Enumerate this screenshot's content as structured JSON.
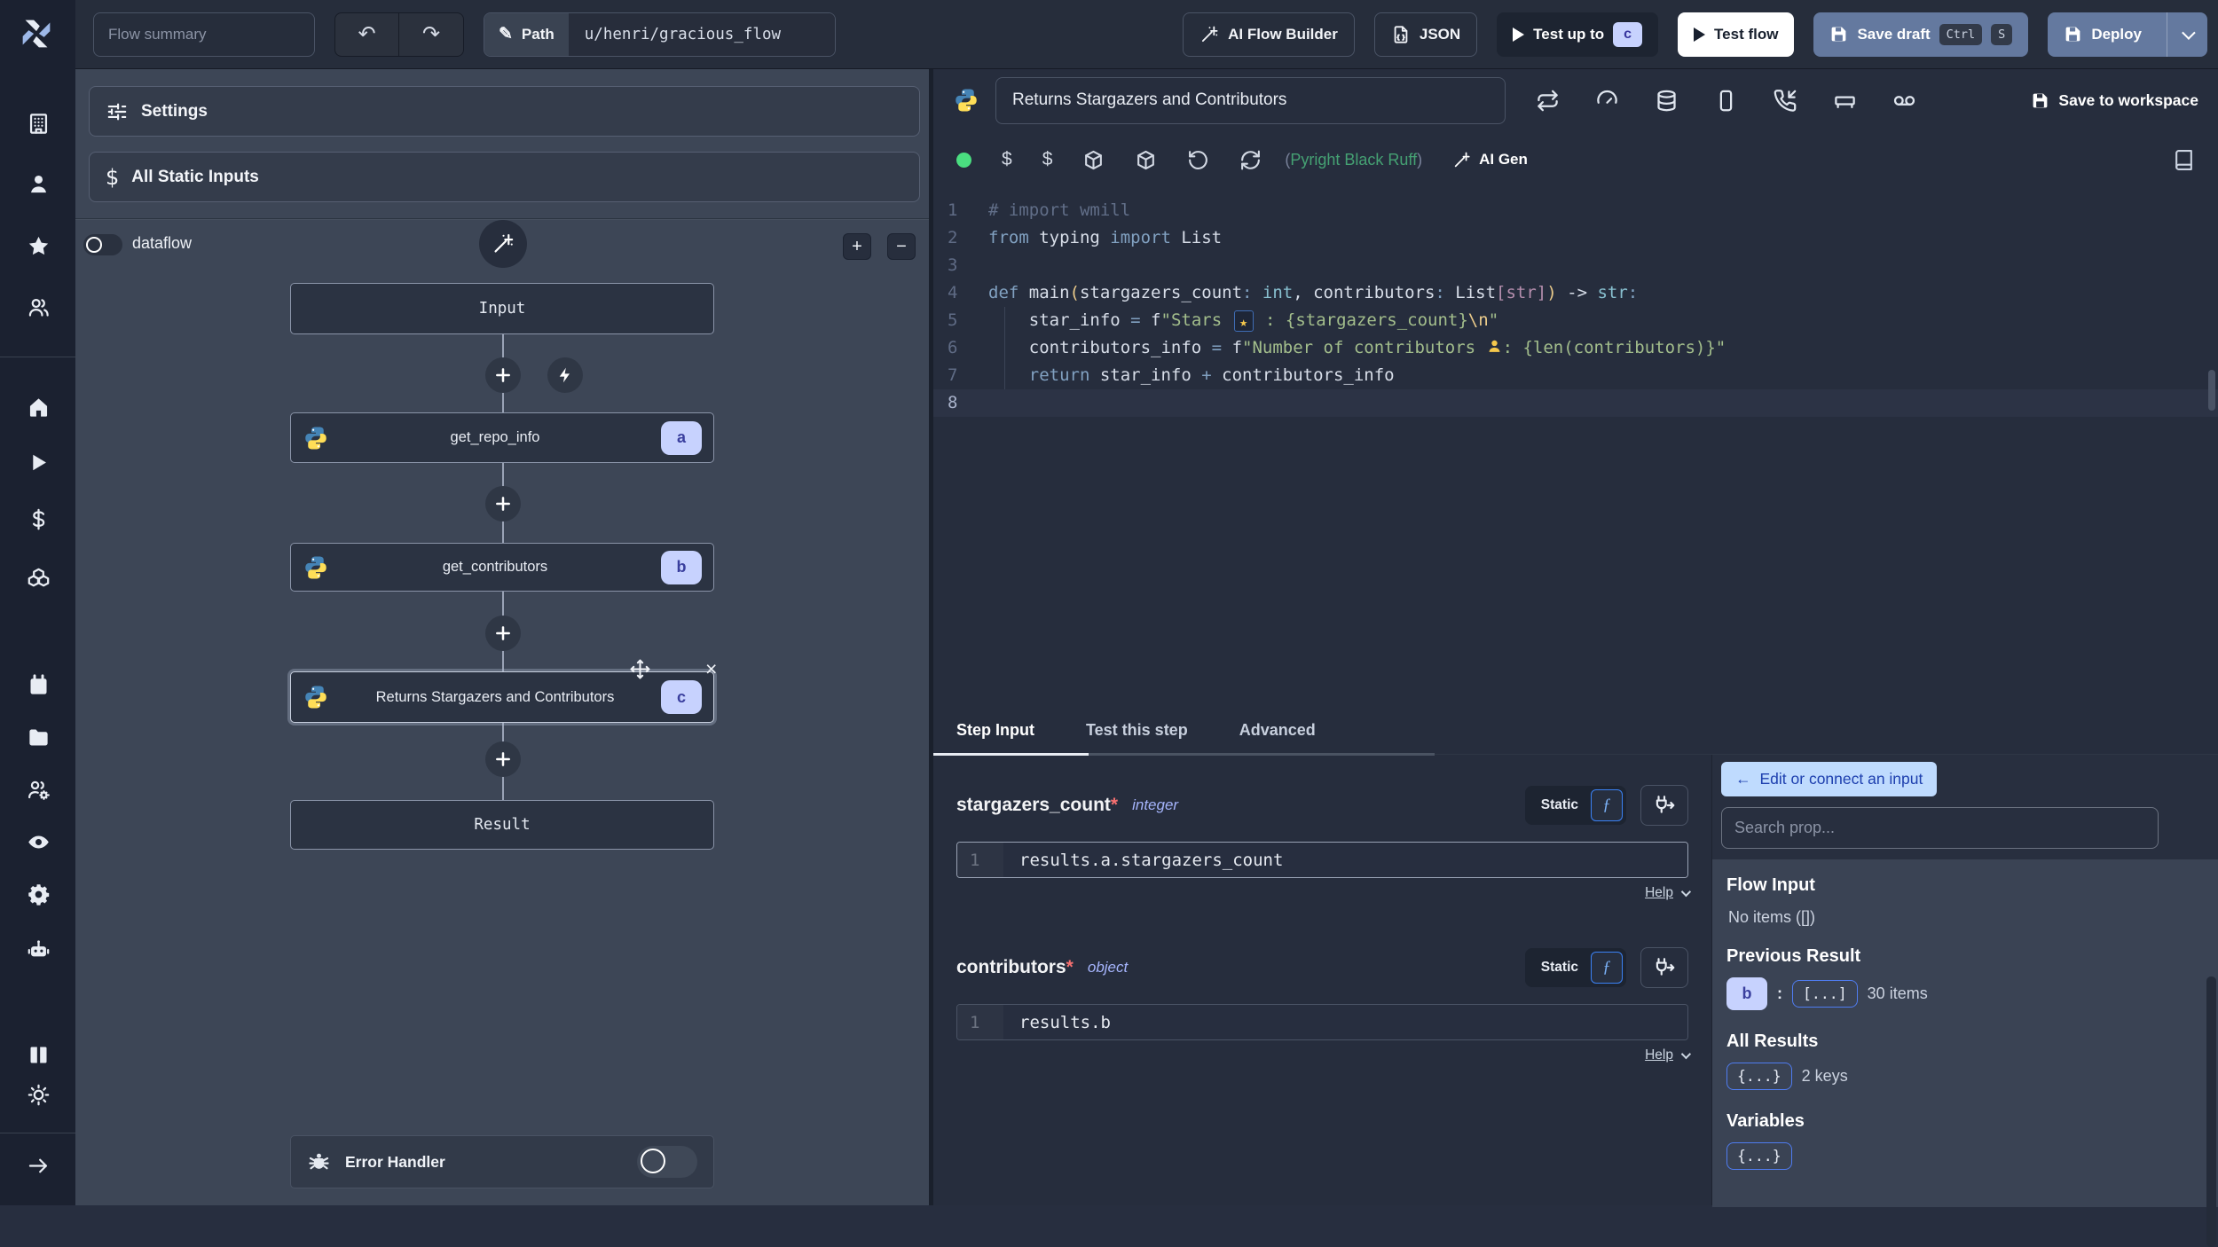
{
  "topbar": {
    "flow_summary_placeholder": "Flow summary",
    "path_label": "Path",
    "path_value": "u/henri/gracious_flow",
    "ai_flow_builder_label": "AI Flow Builder",
    "json_label": "JSON",
    "test_up_to_label": "Test up to",
    "test_up_to_badge": "c",
    "test_flow_label": "Test flow",
    "save_draft_label": "Save draft",
    "kbd_ctrl": "Ctrl",
    "kbd_s": "S",
    "deploy_label": "Deploy"
  },
  "sidebar": {
    "groups": [
      [
        "building",
        "user",
        "star",
        "users"
      ],
      [
        "home",
        "play",
        "dollar",
        "boxes"
      ],
      [
        "calendar",
        "folder",
        "users-cog",
        "eye",
        "gear",
        "robot"
      ],
      [
        "books",
        "sun"
      ],
      [
        "arrow-right"
      ]
    ]
  },
  "flow": {
    "settings_label": "Settings",
    "static_inputs_label": "All Static Inputs",
    "dataflow_label": "dataflow",
    "zoom_in": "+",
    "zoom_out": "−",
    "nodes": {
      "input": "Input",
      "a": {
        "label": "get_repo_info",
        "badge": "a"
      },
      "b": {
        "label": "get_contributors",
        "badge": "b"
      },
      "c": {
        "label": "Returns Stargazers and Contributors",
        "badge": "c"
      },
      "result": "Result"
    },
    "error_handler_label": "Error Handler"
  },
  "editor": {
    "title": "Returns Stargazers and Contributors",
    "header_icons": [
      "repeat",
      "gauge",
      "database",
      "smartphone",
      "phone-incoming",
      "bed",
      "voicemail"
    ],
    "save_to_workspace": "Save to workspace",
    "lint": {
      "open": "(",
      "text": "Pyright Black Ruff",
      "close": ")"
    },
    "ai_gen_label": "AI Gen",
    "code": {
      "lines": [
        {
          "n": "1",
          "segs": [
            {
              "st": "c",
              "tx": "# import wmill"
            }
          ]
        },
        {
          "n": "2",
          "segs": [
            {
              "st": "k",
              "tx": "from"
            },
            {
              "st": "w",
              "tx": " typing "
            },
            {
              "st": "k",
              "tx": "import"
            },
            {
              "st": "w",
              "tx": " List"
            }
          ]
        },
        {
          "n": "3",
          "segs": []
        },
        {
          "n": "4",
          "segs": [
            {
              "st": "k",
              "tx": "def"
            },
            {
              "st": "w",
              "tx": " main"
            },
            {
              "st": "p",
              "tx": "("
            },
            {
              "st": "w",
              "tx": "stargazers_count"
            },
            {
              "st": "k",
              "tx": ":"
            },
            {
              "st": "t",
              "tx": " int"
            },
            {
              "st": "w",
              "tx": ", contributors"
            },
            {
              "st": "k",
              "tx": ":"
            },
            {
              "st": "w",
              "tx": " List"
            },
            {
              "st": "m",
              "tx": "[str]"
            },
            {
              "st": "p",
              "tx": ")"
            },
            {
              "st": "w",
              "tx": " -> "
            },
            {
              "st": "t",
              "tx": "str"
            },
            {
              "st": "k",
              "tx": ":"
            }
          ]
        },
        {
          "n": "5",
          "segs": [
            {
              "st": "w",
              "tx": "    star_info "
            },
            {
              "st": "o",
              "tx": "= "
            },
            {
              "st": "w",
              "tx": "f"
            },
            {
              "st": "s",
              "tx": "\"Stars "
            },
            {
              "ic": "star-emoji"
            },
            {
              "st": "s",
              "tx": " : {stargazers_count}"
            },
            {
              "st": "e",
              "tx": "\\n"
            },
            {
              "st": "s",
              "tx": "\""
            }
          ]
        },
        {
          "n": "6",
          "segs": [
            {
              "st": "w",
              "tx": "    contributors_info "
            },
            {
              "st": "o",
              "tx": "= "
            },
            {
              "st": "w",
              "tx": "f"
            },
            {
              "st": "s",
              "tx": "\"Number of contributors "
            },
            {
              "ic": "person-emoji"
            },
            {
              "st": "s",
              "tx": ": {len(contributors)}\""
            }
          ]
        },
        {
          "n": "7",
          "segs": [
            {
              "st": "k",
              "tx": "    return"
            },
            {
              "st": "w",
              "tx": " star_info "
            },
            {
              "st": "o",
              "tx": "+"
            },
            {
              "st": "w",
              "tx": " contributors_info"
            }
          ]
        },
        {
          "n": "8",
          "segs": [],
          "current": true
        }
      ]
    }
  },
  "step_panel": {
    "tabs": [
      "Step Input",
      "Test this step",
      "Advanced"
    ],
    "fields": [
      {
        "name": "stargazers_count",
        "required": "*",
        "type": "integer",
        "mode": "Static",
        "expr_line": "1",
        "expr": "results.a.stargazers_count",
        "help": "Help"
      },
      {
        "name": "contributors",
        "required": "*",
        "type": "object",
        "mode": "Static",
        "expr_line": "1",
        "expr": "results.b",
        "help": "Help"
      }
    ]
  },
  "prop_panel": {
    "back_arrow": "←",
    "back_label": "Edit or connect an input",
    "search_placeholder": "Search prop...",
    "flow_input_title": "Flow Input",
    "flow_input_empty": "No items ([])",
    "previous_result_title": "Previous Result",
    "previous_result_badge": "b",
    "colon": ":",
    "array_badge": "[...]",
    "previous_result_count": "30 items",
    "all_results_title": "All Results",
    "object_badge": "{...}",
    "all_results_count": "2 keys",
    "variables_title": "Variables"
  },
  "colors": {
    "accent_blue_button": "#64799f",
    "lavender_badge": "#c7d2fe",
    "light_blue_button": "#bfdbfe",
    "green_status_dot": "#4ade80",
    "lint_green": "#45a173",
    "string_green": "#a3be8c",
    "keyword_blue": "#81a1c1",
    "panel_gray": "#3d4656",
    "editor_bg": "#262d3d"
  }
}
